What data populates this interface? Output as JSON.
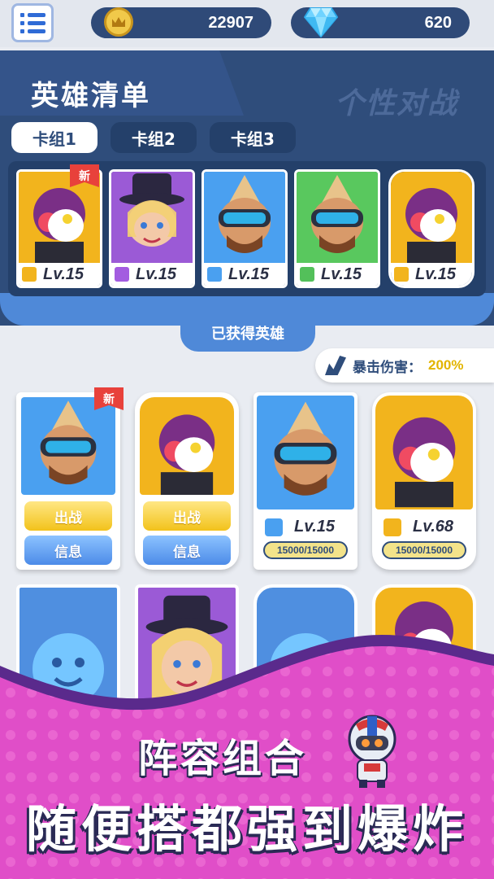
{
  "currency": {
    "coins": "22907",
    "gems": "620"
  },
  "panel": {
    "title": "英雄清单",
    "watermark": "个性对战",
    "tabs": [
      {
        "label": "卡组1",
        "active": true
      },
      {
        "label": "卡组2",
        "active": false
      },
      {
        "label": "卡组3",
        "active": false
      }
    ],
    "deck_cards": [
      {
        "hero": "clown-villain",
        "level": "Lv.15",
        "new": true,
        "bg": "#f2b41d",
        "rarity_color": "#f2b41d"
      },
      {
        "hero": "witch-girl",
        "level": "Lv.15",
        "new": false,
        "bg": "#9b5ad6",
        "rarity_color": "#a35ce0"
      },
      {
        "hero": "goggle-pilot",
        "level": "Lv.15",
        "new": false,
        "bg": "#4aa0f0",
        "rarity_color": "#4aa0f0"
      },
      {
        "hero": "goggle-pilot",
        "level": "Lv.15",
        "new": false,
        "bg": "#59c85e",
        "rarity_color": "#53c05a"
      },
      {
        "hero": "clown-villain",
        "level": "Lv.15",
        "new": false,
        "bg": "#f2b41d",
        "rarity_color": "#f2b41d"
      }
    ],
    "new_label": "新",
    "obtained_label": "已获得英雄"
  },
  "crit": {
    "label": "暴击伤害：",
    "value": "200%"
  },
  "grid": {
    "deploy_label": "出战",
    "info_label": "信息",
    "cards": [
      {
        "hero": "goggle-pilot",
        "bg": "#4aa0f0",
        "new": true,
        "type": "buttons"
      },
      {
        "hero": "clown-villain",
        "bg": "#f2b41d",
        "new": false,
        "type": "buttons"
      },
      {
        "hero": "goggle-pilot",
        "bg": "#4aa0f0",
        "new": false,
        "type": "level",
        "level": "Lv.15",
        "hp": "15000/15000",
        "rarity_color": "#4aa0f0"
      },
      {
        "hero": "clown-villain",
        "bg": "#f2b41d",
        "new": false,
        "type": "level",
        "level": "Lv.68",
        "hp": "15000/15000",
        "rarity_color": "#f2b41d"
      }
    ]
  },
  "promo": {
    "line1": "阵容组合",
    "line2": "随便搭都强到爆炸"
  }
}
